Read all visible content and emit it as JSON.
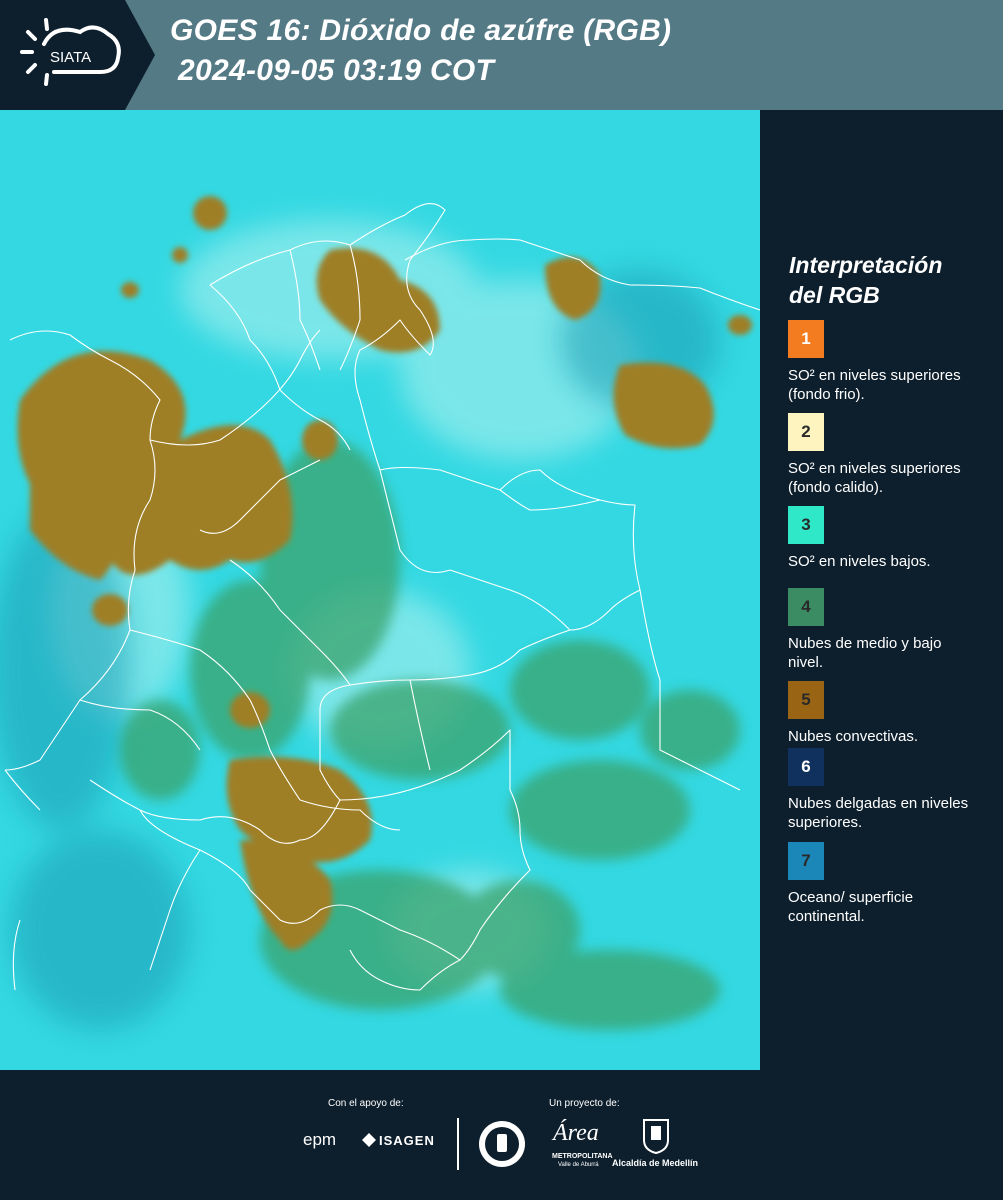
{
  "header": {
    "logo_text": "SIATA",
    "title_line1": "GOES 16: Dióxido de azúfre (RGB)",
    "title_line2": "2024-09-05 03:19 COT"
  },
  "legend": {
    "title_line1": "Interpretación",
    "title_line2": "del RGB",
    "items": [
      {
        "number": "1",
        "color": "#f47c20",
        "text": "SO² en niveles superiores (fondo frio)."
      },
      {
        "number": "2",
        "color": "#fdf4c0",
        "text": "SO² en niveles superiores (fondo calido)."
      },
      {
        "number": "3",
        "color": "#2ee8c8",
        "text": "SO² en niveles bajos."
      },
      {
        "number": "4",
        "color": "#3b8c63",
        "text": "Nubes de medio y bajo nivel."
      },
      {
        "number": "5",
        "color": "#9a6415",
        "text": "Nubes convectivas."
      },
      {
        "number": "6",
        "color": "#10305e",
        "text": "Nubes delgadas en niveles superiores."
      },
      {
        "number": "7",
        "color": "#1b86b8",
        "text": "Oceano/ superficie continental."
      }
    ]
  },
  "footer": {
    "support_label": "Con el apoyo de:",
    "project_label": "Un proyecto de:",
    "epm_text": "epm",
    "isagen_text": "ISAGEN",
    "area_text": "Área",
    "area_subtitle1": "METROPOLITANA",
    "area_subtitle2": "Valle de Aburrá",
    "alcaldia_text": "Alcaldía de Medellín"
  },
  "colors": {
    "background": "#0d1f2d",
    "header": "#547a86",
    "ocean": "#2fd7df",
    "cloud_brown": "#9a7a22",
    "cloud_green": "#3a9a6a"
  }
}
